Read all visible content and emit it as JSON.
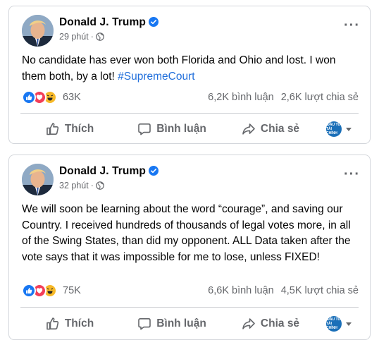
{
  "posts": [
    {
      "author": "Donald J. Trump",
      "time": "29 phút",
      "separator": "·",
      "text": "No candidate has ever won both Florida and Ohio and lost. I won them both, by a lot! ",
      "hashtag": "#SupremeCourt",
      "reactions": "63K",
      "comments": "6,2K bình luận",
      "shares": "2,6K lượt chia sẻ"
    },
    {
      "author": "Donald J. Trump",
      "time": "32 phút",
      "separator": "·",
      "text": "We will soon be learning about the word “courage”, and saving our Country. I received hundreds of thousands of legal votes more, in all of the Swing States, than did my opponent.   ALL Data taken after the vote says that it was impossible for me to lose, unless FIXED!",
      "hashtag": "",
      "reactions": "75K",
      "comments": "6,6K bình luận",
      "shares": "4,5K lượt chia sẻ"
    }
  ],
  "actions": {
    "like": "Thích",
    "comment": "Bình luận",
    "share": "Chia sẻ"
  },
  "page_avatar": {
    "line1": "ĐẦU TƯ",
    "line2": "TÀI CHÍNH"
  },
  "icons": {
    "verified": "verified-badge-icon",
    "globe": "globe-icon",
    "more": "more-options-icon",
    "like": "thumbs-up-icon",
    "comment": "comment-bubble-icon",
    "share": "share-arrow-icon"
  },
  "colors": {
    "accent": "#1877f2",
    "hashtag": "#216fdb",
    "secondary_text": "#65676b"
  }
}
